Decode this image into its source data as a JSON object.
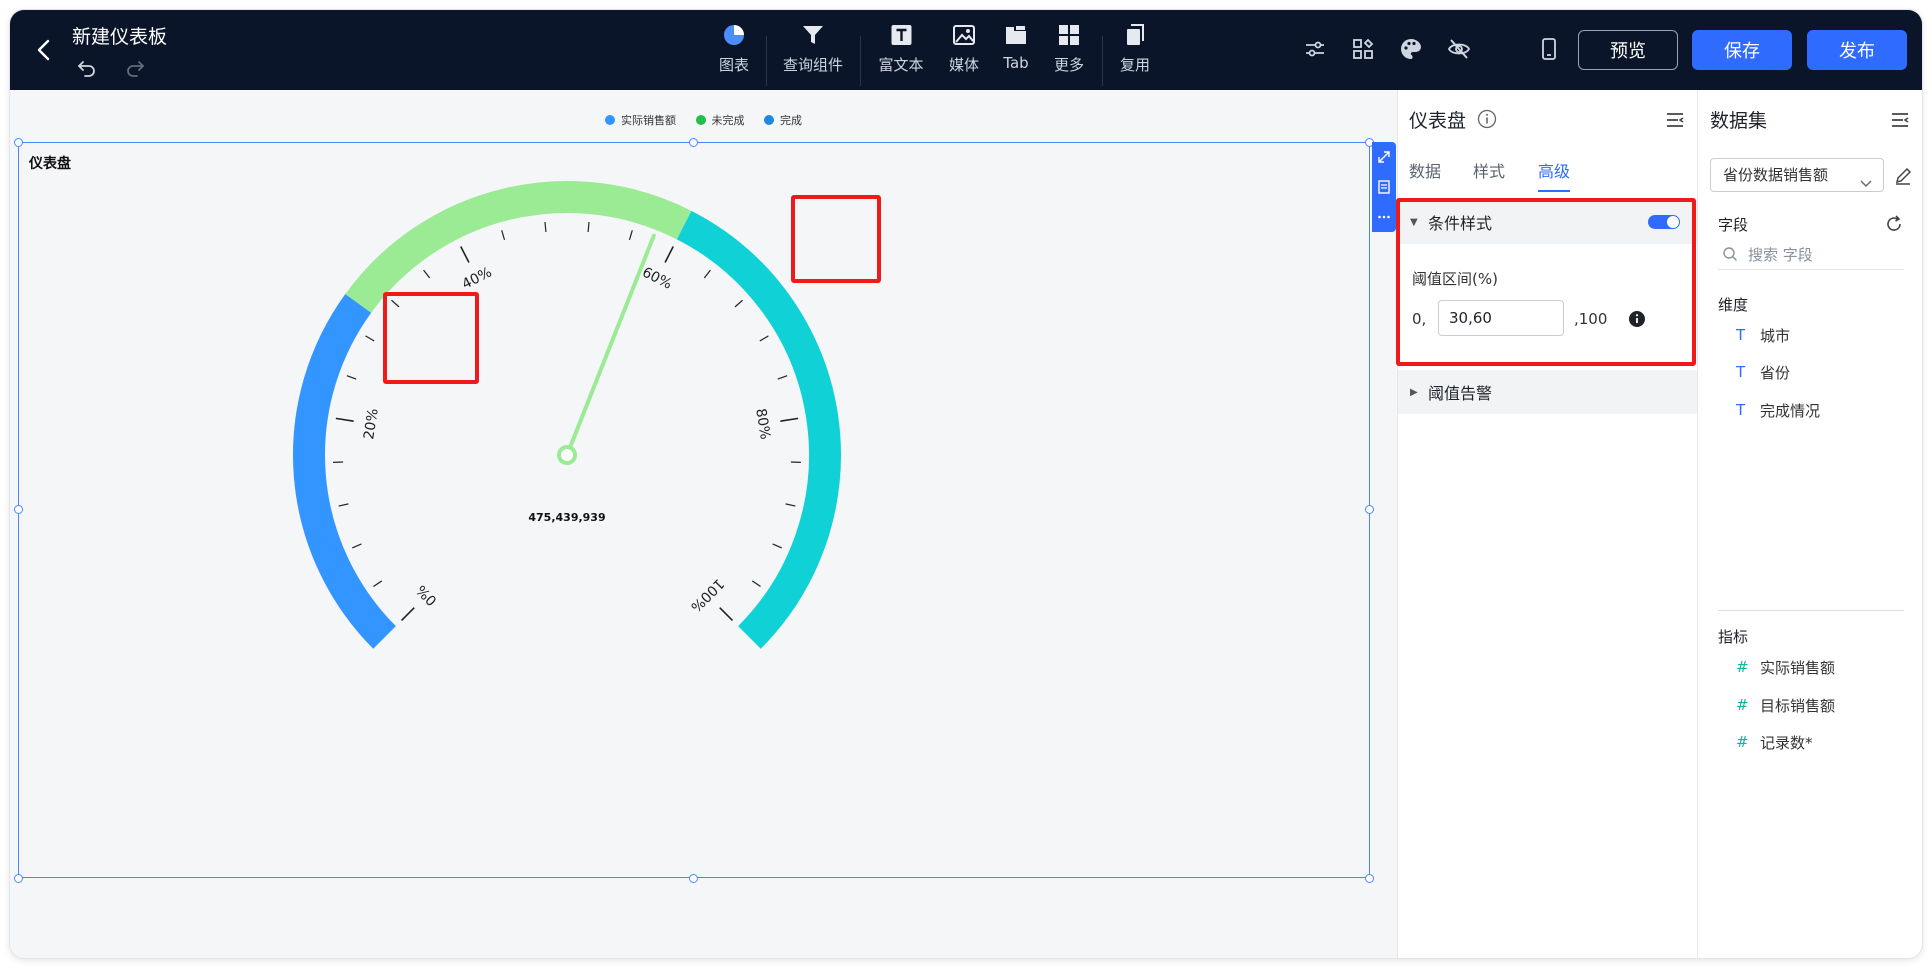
{
  "header": {
    "title": "新建仪表板",
    "tools": [
      {
        "name": "chart",
        "label": "图表",
        "icon": "pie-chart-icon"
      },
      {
        "name": "query-component",
        "label": "查询组件",
        "icon": "filter-icon"
      },
      {
        "name": "rich-text",
        "label": "富文本",
        "icon": "text-icon"
      },
      {
        "name": "media",
        "label": "媒体",
        "icon": "image-icon"
      },
      {
        "name": "tab",
        "label": "Tab",
        "icon": "tab-icon"
      },
      {
        "name": "more",
        "label": "更多",
        "icon": "grid-icon"
      },
      {
        "name": "reuse",
        "label": "复用",
        "icon": "copy-icon"
      }
    ],
    "preview_label": "预览",
    "save_label": "保存",
    "publish_label": "发布"
  },
  "colors": {
    "accent": "#2f6bff",
    "topbar": "#0b1529",
    "gauge_blue": "#3395ff",
    "gauge_green": "#9beb94",
    "gauge_cyan": "#10d2d6",
    "highlight_red": "#f01a1a"
  },
  "canvas": {
    "legend": [
      {
        "label": "实际销售额",
        "color": "#3395ff"
      },
      {
        "label": "未完成",
        "color": "#1fbf4a"
      },
      {
        "label": "完成",
        "color": "#1f87e0"
      }
    ],
    "widget_title": "仪表盘",
    "gauge": {
      "value_text": "475,439,939",
      "pointer_percent": 58,
      "thresholds_percent": [
        30,
        60
      ],
      "major_tick_labels": [
        "0%",
        "20%",
        "40%",
        "60%",
        "80%",
        "100%"
      ]
    }
  },
  "chart_data": {
    "type": "gauge",
    "min": 0,
    "max": 100,
    "value_percent": 58,
    "value_label": "475,439,939",
    "bands": [
      {
        "from": 0,
        "to": 30,
        "color": "#3395ff"
      },
      {
        "from": 30,
        "to": 60,
        "color": "#9beb94"
      },
      {
        "from": 60,
        "to": 100,
        "color": "#10d2d6"
      }
    ],
    "tick_labels": [
      "0%",
      "20%",
      "40%",
      "60%",
      "80%",
      "100%"
    ],
    "title": "仪表盘"
  },
  "property_panel": {
    "title": "仪表盘",
    "tabs": [
      "数据",
      "样式",
      "高级"
    ],
    "active_tab": "高级",
    "condition_style": {
      "label": "条件样式",
      "enabled": true,
      "threshold_label": "阈值区间(%)",
      "prefix": "0,",
      "value": "30,60",
      "suffix": ",100"
    },
    "threshold_alert_label": "阈值告警"
  },
  "dataset_panel": {
    "title": "数据集",
    "selected_dataset": "省份数据销售额",
    "fields_label": "字段",
    "search_placeholder": "搜索 字段",
    "dimensions_label": "维度",
    "dimensions": [
      {
        "type": "T",
        "name": "城市"
      },
      {
        "type": "T",
        "name": "省份"
      },
      {
        "type": "T",
        "name": "完成情况"
      }
    ],
    "measures_label": "指标",
    "measures": [
      {
        "type": "#",
        "name": "实际销售额"
      },
      {
        "type": "#",
        "name": "目标销售额"
      },
      {
        "type": "#",
        "name": "记录数*"
      }
    ]
  }
}
